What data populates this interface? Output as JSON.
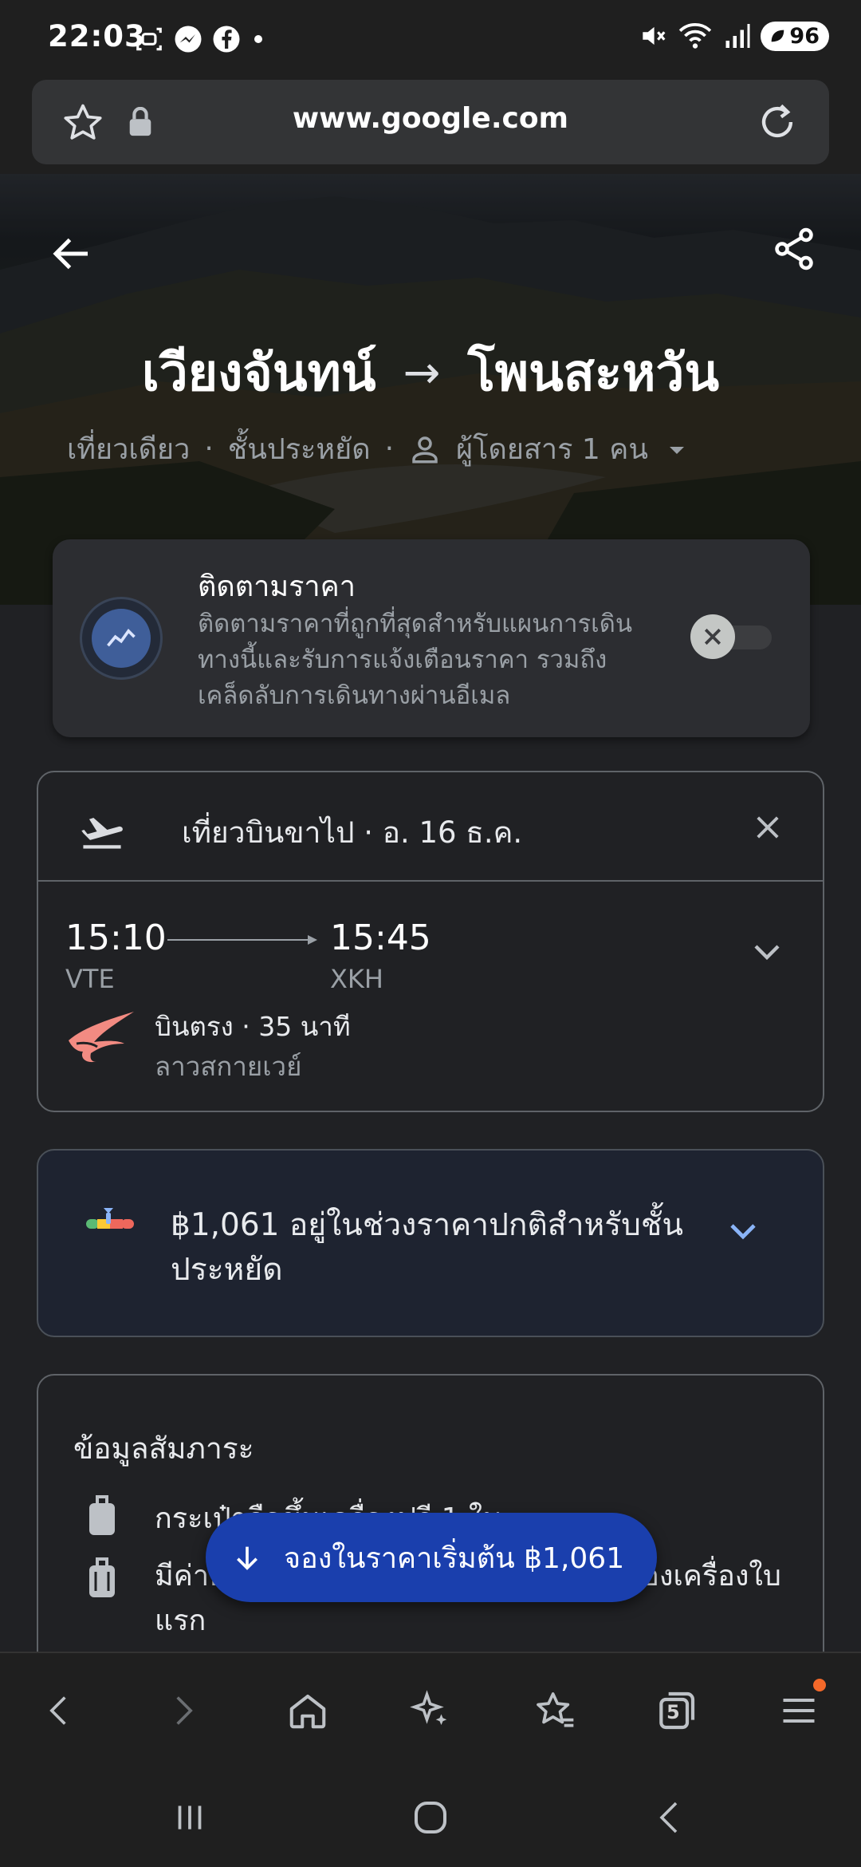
{
  "status_bar": {
    "time": "22:03",
    "battery": "96",
    "left_icons": [
      "screenshot-icon",
      "messenger-icon",
      "facebook-icon",
      "dot-icon"
    ],
    "right_icons": [
      "mute-icon",
      "wifi-icon",
      "signal-icon",
      "battery-icon"
    ]
  },
  "url_bar": {
    "url": "www.google.com"
  },
  "hero": {
    "origin": "เวียงจันทน์",
    "arrow": "→",
    "destination": "โพนสะหวัน",
    "trip_type": "เที่ยวเดียว",
    "cabin_class": "ชั้นประหยัด",
    "passengers": "ผู้โดยสาร 1 คน",
    "separator": "·"
  },
  "price_tracking": {
    "title": "ติดตามราคา",
    "description": "ติดตามราคาที่ถูกที่สุดสำหรับแผนการเดินทางนี้และรับการแจ้งเตือนราคา รวมถึงเคล็ดลับการเดินทางผ่านอีเมล",
    "enabled": false
  },
  "outbound": {
    "header": "เที่ยวบินขาไป · อ. 16 ธ.ค.",
    "departure_time": "15:10",
    "arrival_time": "15:45",
    "departure_code": "VTE",
    "arrival_code": "XKH",
    "details": "บินตรง · 35 นาที",
    "airline": "ลาวสกายเวย์"
  },
  "price_insight": {
    "text": "฿1,061 อยู่ในช่วงราคาปกติสำหรับชั้นประหยัด",
    "colors": [
      "#5bb974",
      "#fcc934",
      "#ee675c",
      "#8ab4f8"
    ]
  },
  "baggage": {
    "title": "ข้อมูลสัมภาระ",
    "item1": "กระเป๋าถือขึ้นเครื่องฟรี 1 ใบ",
    "item2": "มีค่าธรรมเนียมสำหรับกระเป๋าโหลดใต้ท้องเครื่องใบแรก"
  },
  "book_button": {
    "label": "จองในราคาเริ่มต้น ฿1,061"
  },
  "toolbar": {
    "tabs_count": "5"
  },
  "theme": {
    "accent_blue": "#8ab4f8",
    "button_blue": "#1a3fad",
    "notification_orange": "#f4692a"
  }
}
